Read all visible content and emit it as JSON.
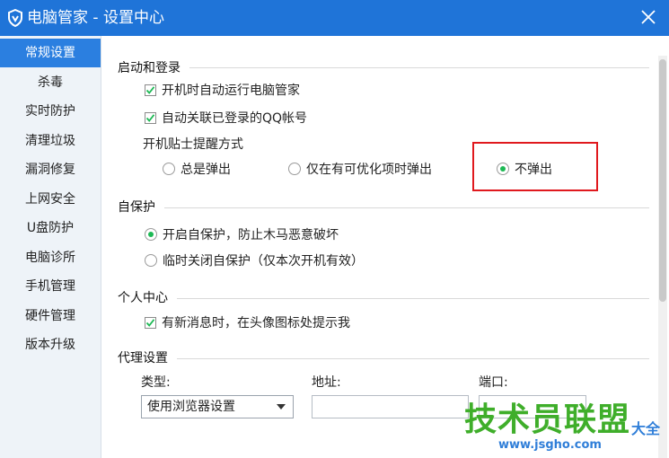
{
  "window": {
    "title": "电脑管家 - 设置中心"
  },
  "sidebar": {
    "items": [
      {
        "label": "常规设置"
      },
      {
        "label": "杀毒"
      },
      {
        "label": "实时防护"
      },
      {
        "label": "清理垃圾"
      },
      {
        "label": "漏洞修复"
      },
      {
        "label": "上网安全"
      },
      {
        "label": "U盘防护"
      },
      {
        "label": "电脑诊所"
      },
      {
        "label": "手机管理"
      },
      {
        "label": "硬件管理"
      },
      {
        "label": "版本升级"
      }
    ]
  },
  "startup": {
    "title": "启动和登录",
    "auto_run": {
      "label": "开机时自动运行电脑管家",
      "checked": true
    },
    "auto_qq": {
      "label": "自动关联已登录的QQ帐号",
      "checked": true
    },
    "tip_mode_label": "开机贴士提醒方式",
    "tip_options": [
      {
        "label": "总是弹出",
        "selected": false
      },
      {
        "label": "仅在有可优化项时弹出",
        "selected": false
      },
      {
        "label": "不弹出",
        "selected": true
      }
    ]
  },
  "self_protect": {
    "title": "自保护",
    "options": [
      {
        "label": "开启自保护，防止木马恶意破坏",
        "selected": true
      },
      {
        "label": "临时关闭自保护（仅本次开机有效）",
        "selected": false
      }
    ]
  },
  "personal": {
    "title": "个人中心",
    "notify": {
      "label": "有新消息时，在头像图标处提示我",
      "checked": true
    }
  },
  "proxy": {
    "title": "代理设置",
    "type_label": "类型:",
    "type_value": "使用浏览器设置",
    "address_label": "地址:",
    "port_label": "端口:"
  },
  "watermark": {
    "main": "技术员联盟",
    "url": "www.jsgho.com",
    "side": "大全"
  },
  "colors": {
    "titlebar": "#1f74d8",
    "sidebar_active": "#2b7fe0",
    "radio_selected": "#1db954",
    "highlight": "#e0191e",
    "watermark_green": "#3fae2a"
  }
}
